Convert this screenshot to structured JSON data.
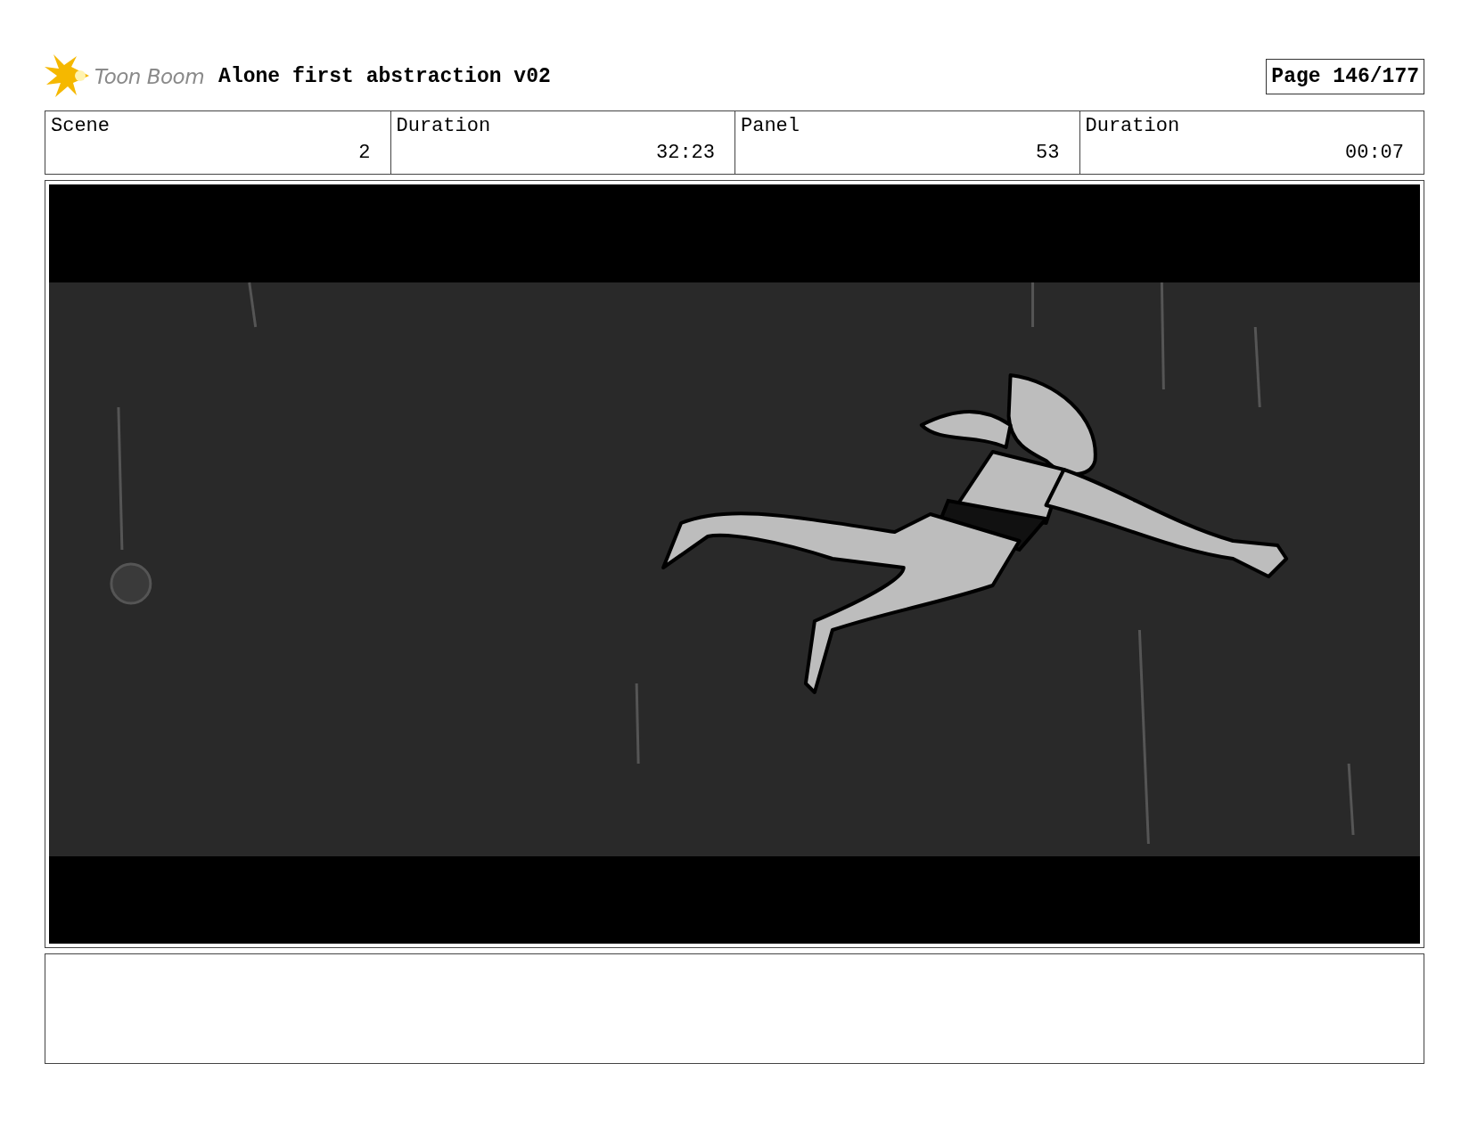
{
  "header": {
    "logo_text": "Toon Boom",
    "title": "Alone first abstraction v02",
    "page": "Page 146/177"
  },
  "info": [
    {
      "label": "Scene",
      "value": "2"
    },
    {
      "label": "Duration",
      "value": "32:23"
    },
    {
      "label": "Panel",
      "value": "53"
    },
    {
      "label": "Duration",
      "value": "00:07"
    }
  ]
}
